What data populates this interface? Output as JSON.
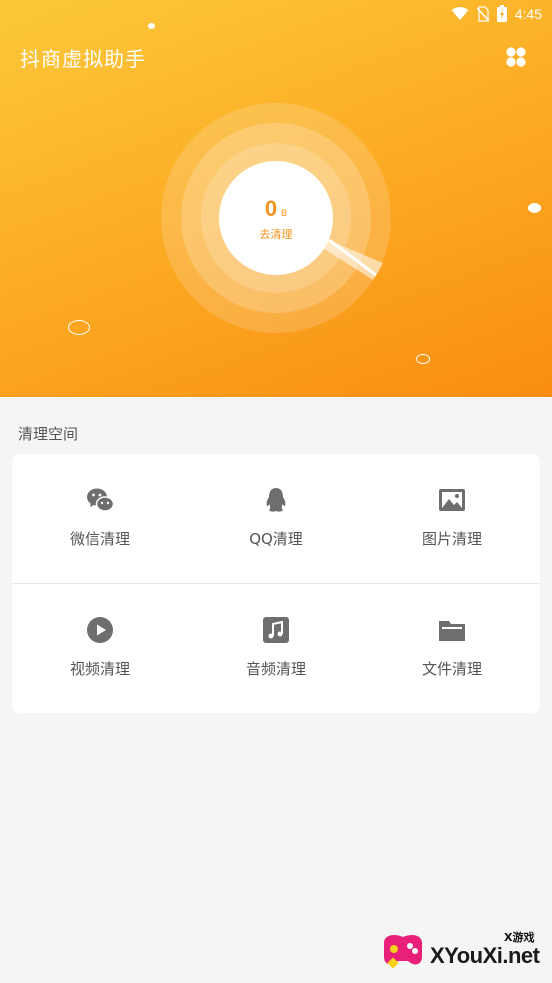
{
  "status_bar": {
    "time": "4:45"
  },
  "header": {
    "app_title": "抖商虚拟助手"
  },
  "cleaner": {
    "size_value": "0",
    "size_unit": "B",
    "action_label": "去清理"
  },
  "section": {
    "title": "清理空间"
  },
  "tiles": [
    {
      "label": "微信清理",
      "icon": "wechat-icon"
    },
    {
      "label": "QQ清理",
      "icon": "qq-icon"
    },
    {
      "label": "图片清理",
      "icon": "image-icon"
    },
    {
      "label": "视频清理",
      "icon": "video-play-icon"
    },
    {
      "label": "音频清理",
      "icon": "music-note-icon"
    },
    {
      "label": "文件清理",
      "icon": "folder-icon"
    }
  ],
  "watermark": {
    "top_text": "X游戏",
    "text": "XYouXi.net"
  },
  "colors": {
    "accent": "#f5941d",
    "hero_start": "#fcc83a",
    "hero_end": "#f98d12",
    "icon_gray": "#6e6e6e"
  }
}
